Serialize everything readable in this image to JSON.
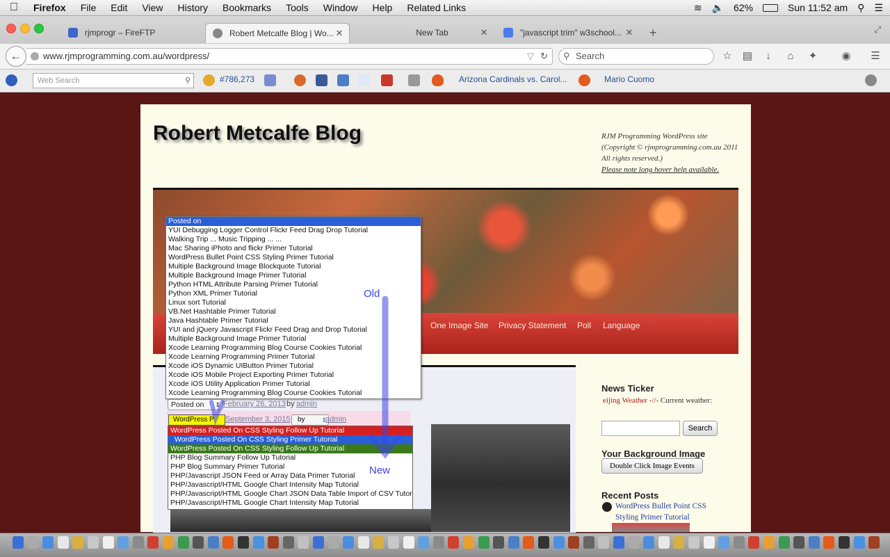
{
  "menubar": {
    "app": "Firefox",
    "items": [
      "File",
      "Edit",
      "View",
      "History",
      "Bookmarks",
      "Tools",
      "Window",
      "Help",
      "Related Links"
    ],
    "battery": "62%",
    "clock": "Sun 11:52 am"
  },
  "tabs": [
    {
      "label": "rjmprogr – FireFTP",
      "active": false
    },
    {
      "label": "Robert Metcalfe Blog | Wo...",
      "active": true
    },
    {
      "label": "New Tab",
      "active": false
    },
    {
      "label": "\"javascript trim\" w3school...",
      "active": false
    }
  ],
  "nav": {
    "url": "www.rjmprogramming.com.au/wordpress/",
    "search_placeholder": "Search"
  },
  "toolbar2": {
    "websearch_placeholder": "Web Search",
    "count": "#786,273",
    "news1": "Arizona Cardinals vs. Carol...",
    "news2": "Mario Cuomo"
  },
  "blog": {
    "title": "Robert Metcalfe Blog",
    "desc1": "RJM Programming WordPress site (Copyright © rjmprogramming.com.au 2011 All rights reserved.)",
    "desc2": "Please note long hover help available.",
    "nav_items": [
      "One Image Site",
      "Privacy Statement",
      "Poll",
      "Language"
    ]
  },
  "old_select": {
    "options": [
      "Posted on",
      "YUI Debugging Logger Control Flickr Feed Drag Drop Tutorial",
      "Walking Trip ... Music Tripping ... ...",
      "Mac Sharing iPhoto and flickr Primer Tutorial",
      "WordPress Bullet Point CSS Styling Primer Tutorial",
      "Multiple Background Image Blockquote Tutorial",
      "Multiple Background Image Primer Tutorial",
      "Python HTML Attribute Parsing Primer Tutorial",
      "Python XML Primer Tutorial",
      "Linux sort Tutorial",
      "VB.Net Hashtable Primer Tutorial",
      "Java Hashtable Primer Tutorial",
      "YUI and jQuery Javascript Flickr Feed Drag and Drop Tutorial",
      "Multiple Background Image Primer Tutorial",
      "Xcode Learning Programming Blog Course Cookies Tutorial",
      "Xcode Learning Programming Primer Tutorial",
      "Xcode iOS Dynamic UIButton Primer Tutorial",
      "Xcode iOS Mobile Project Exporting Primer Tutorial",
      "Xcode iOS Utility Application Primer Tutorial",
      "Xcode Learning Programming Blog Course Cookies Tutorial"
    ],
    "selected_index": 0,
    "closed_label": "Posted on",
    "date": "February 26, 2013",
    "by": "by",
    "author": "admin"
  },
  "new_select": {
    "closed_label": "WordPress P",
    "date": "September 3, 2015",
    "by": "by",
    "author": "admin",
    "options": [
      {
        "label": "WordPress Posted On CSS Styling Follow Up Tutorial",
        "bg": "#d42020",
        "fg": "#fff"
      },
      {
        "label": "WordPress Posted On CSS Styling Primer Tutorial",
        "bg": "#2a5fd8",
        "fg": "#fff"
      },
      {
        "label": "WordPress Posted On CSS Styling Follow Up Tutorial",
        "bg": "#3b7a1a",
        "fg": "#fff"
      },
      {
        "label": "PHP Blog Summary Follow Up Tutorial",
        "bg": "#fff",
        "fg": "#111"
      },
      {
        "label": "PHP Blog Summary Primer Tutorial",
        "bg": "#fff",
        "fg": "#111"
      },
      {
        "label": "PHP/Javascript JSON Feed or Array Data Primer Tutorial",
        "bg": "#fff",
        "fg": "#111"
      },
      {
        "label": "PHP/Javascript/HTML Google Chart Intensity Map Tutorial",
        "bg": "#fff",
        "fg": "#111"
      },
      {
        "label": "PHP/Javascript/HTML Google Chart JSON Data Table Import of CSV Tutorial",
        "bg": "#fff",
        "fg": "#111"
      },
      {
        "label": "PHP/Javascript/HTML Google Chart Intensity Map Tutorial",
        "bg": "#fff",
        "fg": "#111"
      }
    ]
  },
  "annotations": {
    "old": "Old",
    "new": "New"
  },
  "sidebar": {
    "ticker_title": "News Ticker",
    "ticker_red": "eijing Weather -//-",
    "ticker_text": "Current weather:",
    "search_button": "Search",
    "bg_title": "Your Background Image",
    "bg_button": "Double Click Image Events",
    "recent_title": "Recent Posts",
    "recent_post": "WordPress Bullet Point CSS Styling Primer Tutorial"
  },
  "colors": {
    "page_bg": "#5a1515",
    "accent_blue": "#3c44e8",
    "nav_red": "#c23228"
  }
}
